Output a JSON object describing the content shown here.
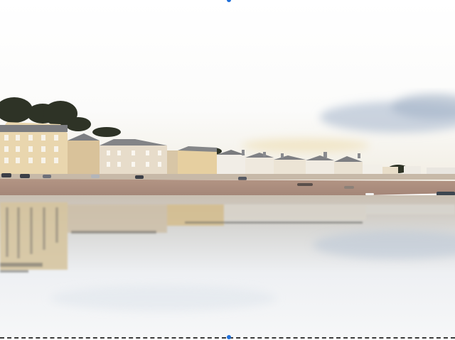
{
  "image": {
    "subject": "seaside-terrace-reflection",
    "colors": {
      "sky_top": "#fefefe",
      "sky_horizon": "#f3efe4",
      "cloud": "#b9c6d6",
      "building_cream": "#efe0bf",
      "building_white": "#f2efe8",
      "roof_grey": "#7d7f83",
      "trees": "#2e3326",
      "beach": "#a5877a",
      "water": "#e9ebee",
      "selection_handle": "#1e6fd9"
    }
  },
  "selection": {
    "handles": [
      "top-center",
      "bottom-center"
    ]
  }
}
